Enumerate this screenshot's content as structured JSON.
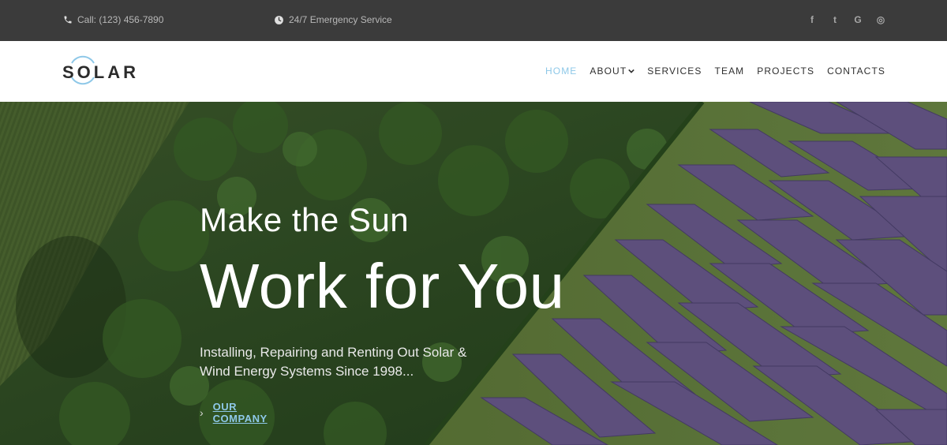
{
  "topbar": {
    "phone": "Call: (123) 456-7890",
    "emergency": "24/7 Emergency Service",
    "social": [
      {
        "icon": "facebook-icon",
        "glyph": "f"
      },
      {
        "icon": "twitter-icon",
        "glyph": "t"
      },
      {
        "icon": "google-icon",
        "glyph": "G"
      },
      {
        "icon": "instagram-icon",
        "glyph": "◎"
      }
    ]
  },
  "header": {
    "logo": "SOLAR",
    "nav": [
      {
        "label": "HOME",
        "active": true
      },
      {
        "label": "ABOUT",
        "dropdown": true
      },
      {
        "label": "SERVICES"
      },
      {
        "label": "TEAM"
      },
      {
        "label": "PROJECTS"
      },
      {
        "label": "CONTACTS"
      }
    ]
  },
  "hero": {
    "headline_1": "Make the Sun",
    "headline_2": "Work for You",
    "subtext": "Installing, Repairing and Renting Out Solar & Wind Energy Systems Since 1998...",
    "cta": "OUR COMPANY"
  },
  "colors": {
    "accent": "#8ec8e8",
    "topbar_bg": "#3b3b3b"
  }
}
